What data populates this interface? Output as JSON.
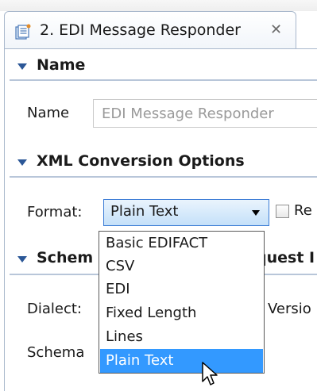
{
  "tab": {
    "title": "2. EDI Message Responder",
    "icon": "editor-document-icon",
    "close_glyph": "✕"
  },
  "sections": {
    "name": {
      "title": "Name"
    },
    "xml_conversion": {
      "title": "XML Conversion Options"
    },
    "schema": {
      "title_visible_left": "Schem",
      "title_visible_right": "quest I"
    }
  },
  "name_field": {
    "label": "Name",
    "value": "EDI Message Responder"
  },
  "format": {
    "label": "Format:",
    "selected": "Plain Text",
    "checkbox_label_partial": "Re",
    "options": [
      "Basic EDIFACT",
      "CSV",
      "EDI",
      "Fixed Length",
      "Lines",
      "Plain Text"
    ]
  },
  "schema_section": {
    "dialect_label": "Dialect:",
    "version_label_partial": "Versio",
    "schema_label": "Schema"
  },
  "colors": {
    "accent": "#3399ff",
    "section_triangle": "#2b5797",
    "combo_border": "#3a7bd5"
  }
}
